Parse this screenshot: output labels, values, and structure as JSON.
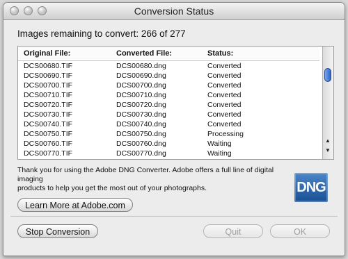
{
  "window": {
    "title": "Conversion Status"
  },
  "status": {
    "remaining": "Images remaining to convert: 266 of 277"
  },
  "list": {
    "headers": [
      "Original File:",
      "Converted File:",
      "Status:"
    ],
    "rows": [
      [
        "DCS00680.TIF",
        "DCS00680.dng",
        "Converted"
      ],
      [
        "DCS00690.TIF",
        "DCS00690.dng",
        "Converted"
      ],
      [
        "DCS00700.TIF",
        "DCS00700.dng",
        "Converted"
      ],
      [
        "DCS00710.TIF",
        "DCS00710.dng",
        "Converted"
      ],
      [
        "DCS00720.TIF",
        "DCS00720.dng",
        "Converted"
      ],
      [
        "DCS00730.TIF",
        "DCS00730.dng",
        "Converted"
      ],
      [
        "DCS00740.TIF",
        "DCS00740.dng",
        "Converted"
      ],
      [
        "DCS00750.TIF",
        "DCS00750.dng",
        "Processing"
      ],
      [
        "DCS00760.TIF",
        "DCS00760.dng",
        "Waiting"
      ],
      [
        "DCS00770.TIF",
        "DCS00770.dng",
        "Waiting"
      ]
    ]
  },
  "message": {
    "line1": "Thank you for using the Adobe DNG Converter.  Adobe offers a full line of digital imaging",
    "line2": "products to help you get the most out of your photographs."
  },
  "logo": {
    "text": "DNG"
  },
  "buttons": {
    "learn": "Learn More at Adobe.com",
    "stop": "Stop Conversion",
    "quit": "Quit",
    "ok": "OK"
  }
}
